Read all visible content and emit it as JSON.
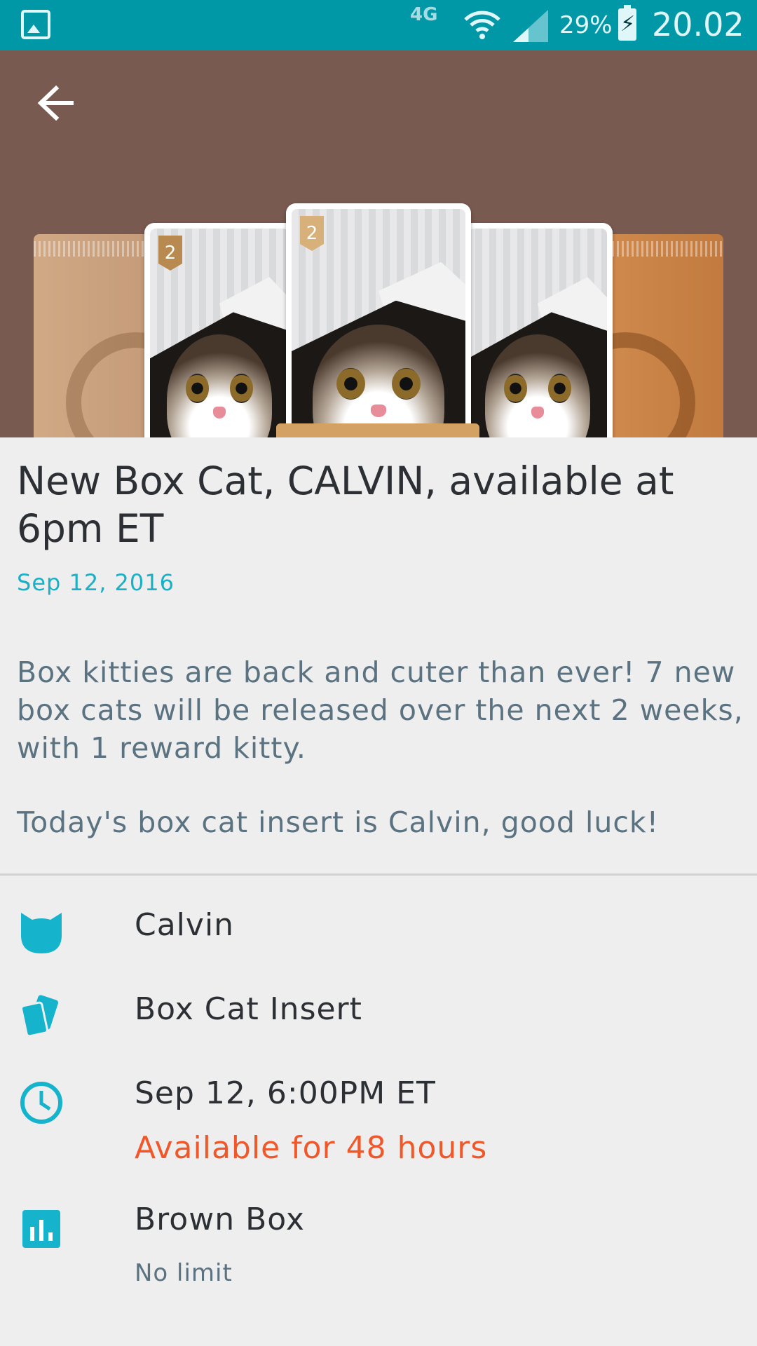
{
  "status_bar": {
    "network": "4G",
    "battery": "29%",
    "time": "20.02",
    "icons": [
      "gallery-icon",
      "wifi-icon",
      "signal-icon",
      "battery-charging-icon"
    ]
  },
  "hero": {
    "back_icon": "arrow-left-icon",
    "vol_number": "2"
  },
  "article": {
    "title": "New Box Cat, CALVIN, available at 6pm ET",
    "date": "Sep 12, 2016",
    "paragraph1": "Box kitties are back and cuter than ever! 7 new box cats will be released over the next 2 weeks, with 1 reward kitty.",
    "paragraph2": "Today's box cat insert is Calvin, good luck!"
  },
  "details": {
    "name": "Calvin",
    "type": "Box Cat Insert",
    "release_time": "Sep 12, 6:00PM ET",
    "availability": "Available for 48 hours",
    "box": "Brown Box",
    "limit": "No limit"
  },
  "colors": {
    "status_bar": "#0097a7",
    "hero_bg": "#795a50",
    "accent": "#1ab0c7",
    "warning": "#f0582a"
  }
}
